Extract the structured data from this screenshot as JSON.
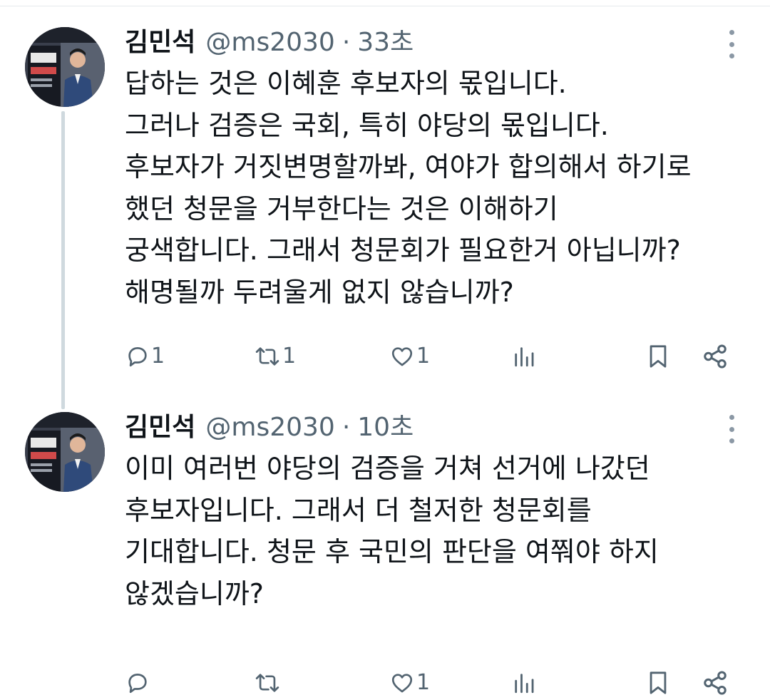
{
  "tweets": [
    {
      "author": "김민석",
      "handle": "@ms2030",
      "separator": "·",
      "time": "33초",
      "lines": [
        "답하는 것은 이혜훈 후보자의 몫입니다.",
        "그러나 검증은 국회, 특히 야당의 몫입니다.",
        "후보자가 거짓변명할까봐, 여야가 합의해서 하기로",
        "했던 청문을 거부한다는 것은 이해하기",
        "궁색합니다. 그래서 청문회가 필요한거 아닙니까?",
        "해명될까 두려울게 없지 않습니까?"
      ],
      "counts": {
        "reply": "1",
        "retweet": "1",
        "like": "1"
      }
    },
    {
      "author": "김민석",
      "handle": "@ms2030",
      "separator": "·",
      "time": "10초",
      "lines": [
        "이미 여러번 야당의 검증을 거쳐 선거에 나갔던",
        "후보자입니다. 그래서 더 철저한 청문회를",
        "기대합니다. 청문 후 국민의 판단을 여쭤야 하지",
        "않겠습니까?"
      ],
      "counts": {
        "reply": "",
        "retweet": "",
        "like": "1"
      }
    }
  ],
  "icons": {
    "reply": "reply-icon",
    "retweet": "retweet-icon",
    "like": "heart-icon",
    "views": "views-icon",
    "bookmark": "bookmark-icon",
    "share": "share-icon",
    "more": "more-vertical-icon"
  },
  "colors": {
    "text": "#0f1419",
    "secondary": "#536471",
    "thread_line": "#cfd9de"
  }
}
